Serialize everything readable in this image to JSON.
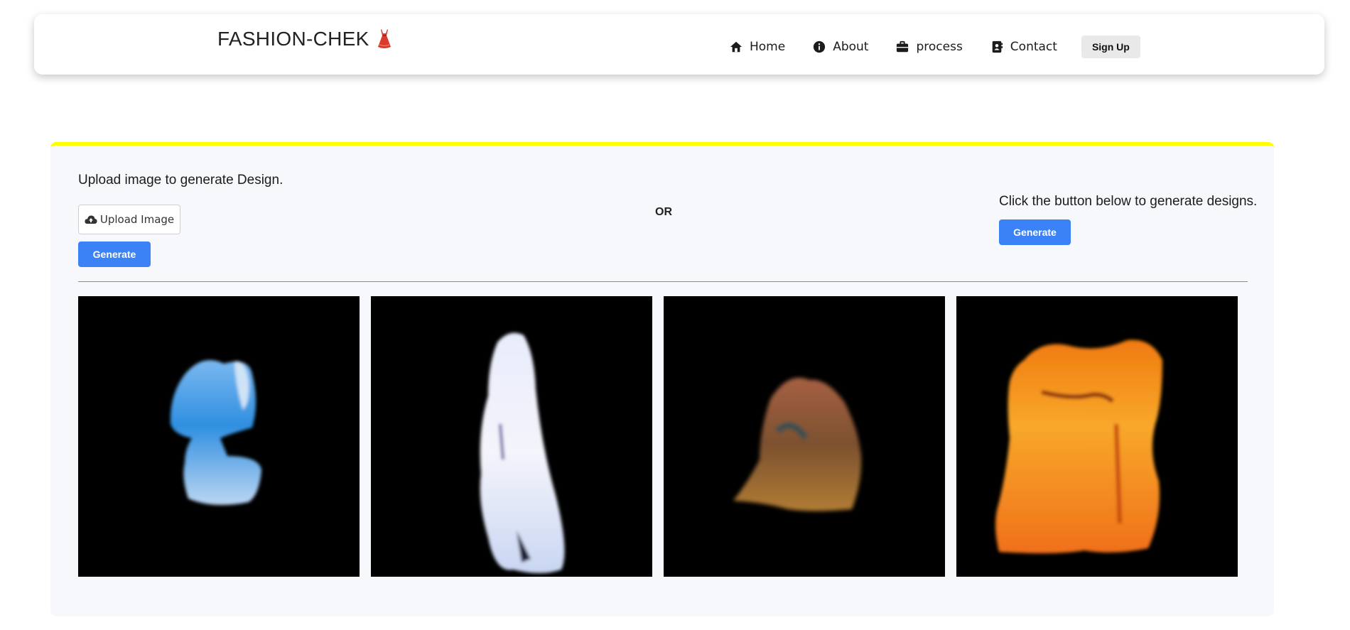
{
  "navbar": {
    "brand": "FASHION-CHEK",
    "brand_icon": "dress-icon",
    "items": [
      {
        "label": "Home",
        "icon": "home-icon"
      },
      {
        "label": "About",
        "icon": "info-icon"
      },
      {
        "label": "process",
        "icon": "briefcase-icon"
      },
      {
        "label": "Contact",
        "icon": "contact-book-icon"
      }
    ],
    "signup_label": "Sign Up"
  },
  "upload_section": {
    "heading": "Upload image to generate Design.",
    "upload_label": "Upload Image",
    "upload_icon": "cloud-upload-icon",
    "generate_label": "Generate"
  },
  "separator_text": "OR",
  "random_section": {
    "heading": "Click the button below to generate designs.",
    "generate_label": "Generate"
  },
  "gallery": {
    "images": [
      {
        "name": "generated-design-blue"
      },
      {
        "name": "generated-design-white"
      },
      {
        "name": "generated-design-brown"
      },
      {
        "name": "generated-design-orange"
      }
    ]
  },
  "colors": {
    "accent": "#3b82f6",
    "card_top_border": "#ffff00",
    "card_bg": "#f7f8fc"
  }
}
